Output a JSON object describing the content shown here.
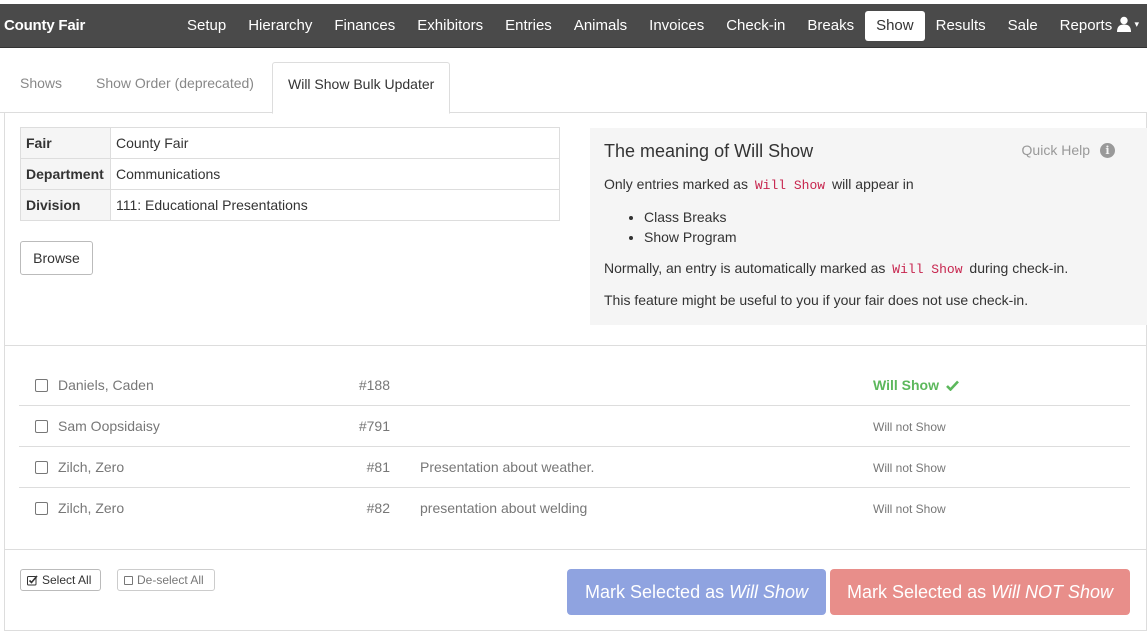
{
  "navbar": {
    "brand": "County Fair",
    "items": [
      "Setup",
      "Hierarchy",
      "Finances",
      "Exhibitors",
      "Entries",
      "Animals",
      "Invoices",
      "Check-in",
      "Breaks",
      "Show",
      "Results",
      "Sale",
      "Reports"
    ],
    "active_item": "Show",
    "user_icon": "user-icon",
    "caret": "▾"
  },
  "tabs": [
    "Shows",
    "Show Order (deprecated)",
    "Will Show Bulk Updater"
  ],
  "active_tab": "Will Show Bulk Updater",
  "info": {
    "rows": [
      {
        "key": "Fair",
        "value": "County Fair"
      },
      {
        "key": "Department",
        "value": "Communications"
      },
      {
        "key": "Division",
        "value": "111: Educational Presentations"
      }
    ],
    "browse_label": "Browse"
  },
  "help": {
    "title": "The meaning of Will Show",
    "quick_help": "Quick Help",
    "line1_before": "Only entries marked as",
    "code": "Will Show",
    "line1_after": "will appear in",
    "list": [
      "Class Breaks",
      "Show Program"
    ],
    "line2_before": "Normally, an entry is automatically marked as",
    "line2_after": "during check-in.",
    "line3": "This feature might be useful to you if your fair does not use check-in."
  },
  "entries": [
    {
      "name": "Daniels, Caden",
      "number": "#188",
      "description": "",
      "status": "Will Show",
      "will_show": true
    },
    {
      "name": "Sam Oopsidaisy",
      "number": "#791",
      "description": "",
      "status": "Will not Show",
      "will_show": false
    },
    {
      "name": "Zilch, Zero",
      "number": "#81",
      "description": "Presentation about weather.",
      "status": "Will not Show",
      "will_show": false
    },
    {
      "name": "Zilch, Zero",
      "number": "#82",
      "description": "presentation about welding",
      "status": "Will not Show",
      "will_show": false
    }
  ],
  "actions": {
    "select_all": "Select All",
    "deselect_all": "De-select All",
    "mark_show_prefix": "Mark Selected as",
    "mark_show_em": "Will Show",
    "mark_not_prefix": "Mark Selected as",
    "mark_not_em": "Will NOT Show"
  },
  "colors": {
    "navbar": "#4a4a4a",
    "will_show": "#5cb85c",
    "mark_show_button": "#8fa3e0",
    "mark_not_button": "#e88e8a"
  }
}
